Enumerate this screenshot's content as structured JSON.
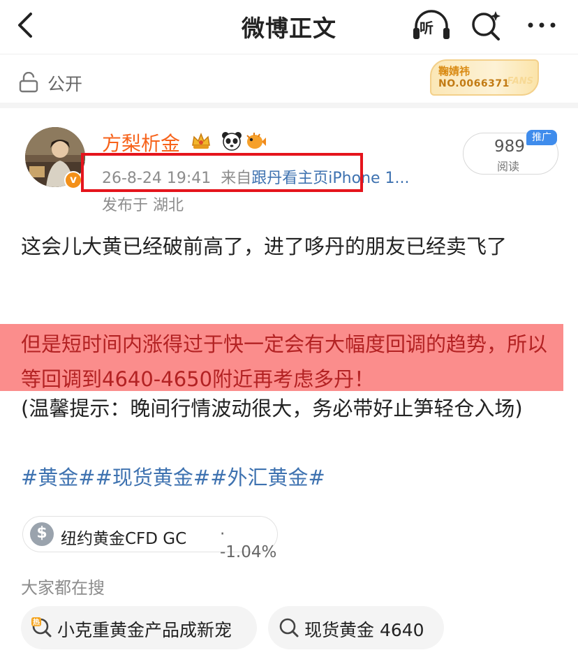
{
  "nav": {
    "title": "微博正文",
    "listen_label": "听"
  },
  "visibility": {
    "label": "公开"
  },
  "fans_badge": {
    "name": "鞠婧祎",
    "number": "NO.0066371",
    "tag": "FANS"
  },
  "post": {
    "author": "方梨析金",
    "verified_mark": "v",
    "badges": [
      "crown-badge",
      "panda-badge",
      "pufferfish-badge"
    ],
    "time": "26-8-24 19:41",
    "source_prefix": "来自",
    "source": "跟丹看主页iPhone 1...",
    "location": "发布于 湖北",
    "reads_count": "989",
    "reads_label": "阅读",
    "promo_label": "推广",
    "paragraph1": "这会儿大黄已经破前高了，进了哆丹的朋友已经卖飞了",
    "paragraph2": "但是短时间内涨得过于快一定会有大幅度回调的趋势，所以等回调到4640-4650附近再考虑多丹！",
    "paragraph3": "(温馨提示：晚间行情波动很大，务必带好止笋轻仓入场)",
    "hashtags": "#黄金##现货黄金##外汇黄金#"
  },
  "stock": {
    "icon_symbol": "$",
    "name": "纽约黄金CFD GC",
    "change": "· -1.04%"
  },
  "search": {
    "section_label": "大家都在搜",
    "chips": [
      {
        "icon": "hot-search-icon",
        "text": "小克重黄金产品成新宠"
      },
      {
        "icon": "search-icon",
        "text": "现货黄金 4640"
      }
    ]
  },
  "colors": {
    "author": "#f7631b",
    "link": "#3e72b0",
    "highlight": "#fb8d8c",
    "annotation_box": "#e5141c",
    "promo": "#3f8cec"
  }
}
